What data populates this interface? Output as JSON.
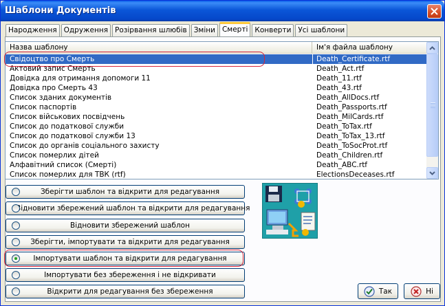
{
  "window": {
    "title": "Шаблони Документів"
  },
  "tabs": [
    {
      "label": "Народження",
      "active": false
    },
    {
      "label": "Одруження",
      "active": false
    },
    {
      "label": "Розірвання шлюбів",
      "active": false
    },
    {
      "label": "Зміни",
      "active": false
    },
    {
      "label": "Смерті",
      "active": true
    },
    {
      "label": "Конверти",
      "active": false
    },
    {
      "label": "Усі шаблони",
      "active": false
    }
  ],
  "grid": {
    "columns": [
      "Назва шаблону",
      "Ім'я файла шаблону"
    ],
    "rows": [
      {
        "name": "Свідоцтво про Смерть",
        "file": "Death_Certificate.rtf",
        "selected": true
      },
      {
        "name": "Актовий запис Смерть",
        "file": "Death_Act.rtf"
      },
      {
        "name": "Довідка для отримання допомоги 11",
        "file": "Death_11.rtf"
      },
      {
        "name": "Довідка про Смерть 43",
        "file": "Death_43.rtf"
      },
      {
        "name": "Список зданих документів",
        "file": "Death_AllDocs.rtf"
      },
      {
        "name": "Список паспортів",
        "file": "Death_Passports.rtf"
      },
      {
        "name": "Список військових посвідчень",
        "file": "Death_MilCards.rtf"
      },
      {
        "name": "Список до податкової служби",
        "file": "Death_ToTax.rtf"
      },
      {
        "name": "Список до податкової служби 13",
        "file": "Death_ToTax_13.rtf"
      },
      {
        "name": "Список до органів соціального захисту",
        "file": "Death_ToSocProt.rtf"
      },
      {
        "name": "Список померлих дітей",
        "file": "Death_Children.rtf"
      },
      {
        "name": "Алфавітний список (Смерті)",
        "file": "Death_ABC.rtf"
      },
      {
        "name": "Список померлих для ТВК (rtf)",
        "file": "ElectionsDeceases.rtf"
      }
    ]
  },
  "options": [
    {
      "label": "Зберігти шаблон та відкрити для редагування",
      "checked": false
    },
    {
      "label": "Відновити збережений шаблон та відкрити для редагування",
      "checked": false
    },
    {
      "label": "Відновити збережений шаблон",
      "checked": false
    },
    {
      "label": "Зберігти, імпортувати та відкрити для редагування",
      "checked": false
    },
    {
      "label": "Імпортувати шаблон та відкрити для редагування",
      "checked": true
    },
    {
      "label": "Імпортувати без збереження і не відкривати",
      "checked": false
    },
    {
      "label": "Відкрити для редагування без збереження",
      "checked": false
    }
  ],
  "buttons": {
    "ok_label": "Так",
    "cancel_label": "Ні"
  },
  "colors": {
    "highlight_annotation": "#d4243a",
    "selection": "#316ac5",
    "title_bar": "#0b56d8"
  }
}
